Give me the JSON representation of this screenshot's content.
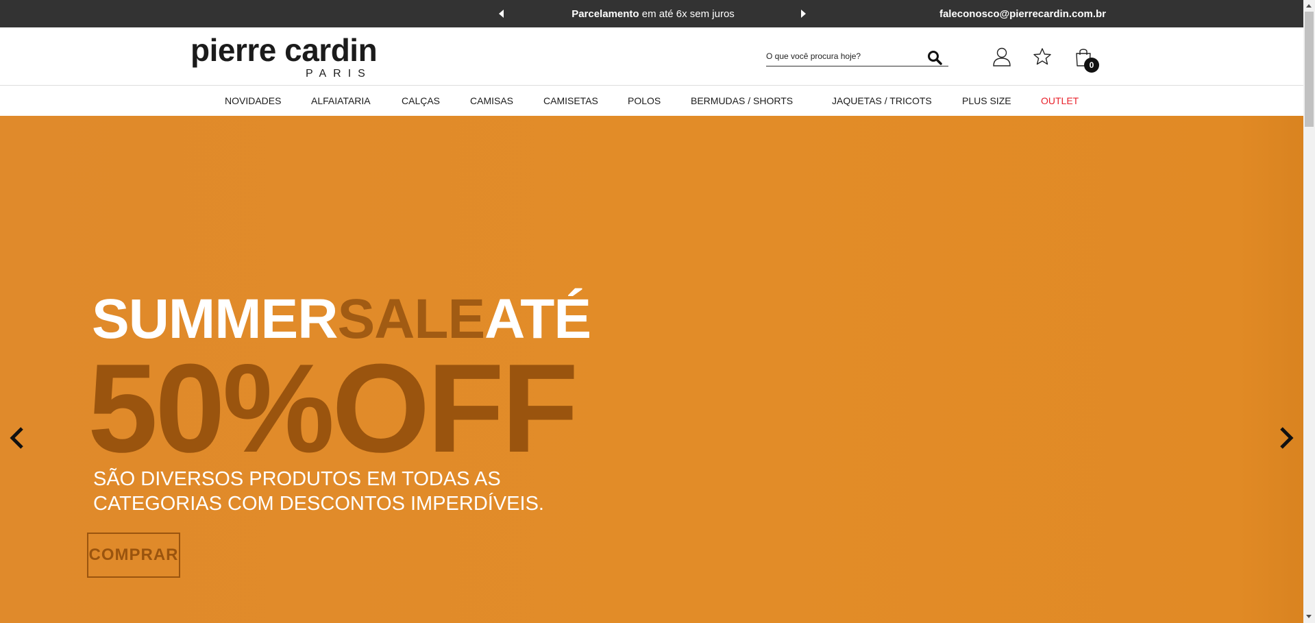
{
  "topbar": {
    "promo_bold": "Parcelamento",
    "promo_rest": " em até 6x sem juros",
    "contact_email": "faleconosco@pierrecardin.com.br"
  },
  "header": {
    "logo_brand": "pierre cardin",
    "logo_sub": "PARIS",
    "search_placeholder": "O que você procura hoje?",
    "cart_count": "0"
  },
  "nav": {
    "items": [
      "NOVIDADES",
      "ALFAIATARIA",
      "CALÇAS",
      "CAMISAS",
      "CAMISETAS",
      "POLOS",
      "BERMUDAS / SHORTS",
      "JAQUETAS / TRICOTS",
      "PLUS SIZE",
      "OUTLET"
    ],
    "outlet_color": "#e8202a"
  },
  "hero": {
    "summer": "SUMMER",
    "sale": "SALE",
    "ate": "ATÉ",
    "discount": "50%OFF",
    "desc_line1": "SÃO DIVERSOS PRODUTOS EM TODAS AS",
    "desc_line2": "CATEGORIAS COM DESCONTOS IMPERDÍVEIS.",
    "cta_label": "COMPRAR",
    "bg_color": "#e28c28",
    "accent_color": "#9a540e"
  }
}
